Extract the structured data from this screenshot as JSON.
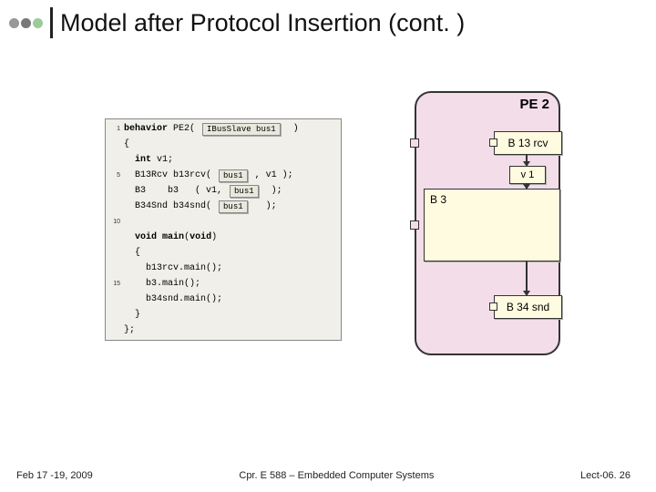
{
  "title": "Model after Protocol Insertion (cont. )",
  "code": {
    "l1a": "behavior",
    "l1b": " PE2( ",
    "l1pill": "IBusSlave bus1",
    "l1c": "  )",
    "l2": "{",
    "l3a": "  ",
    "l3b": "int",
    "l3c": " v1;",
    "l5a": "  B13Rcv b13rcv( ",
    "l5pill": "bus1",
    "l5b": " , v1 );",
    "l7a": "  B3    b3   ( v1, ",
    "l7pill": "bus1",
    "l7b": "  );",
    "l9a": "  B34Snd b34snd( ",
    "l9pill": "bus1",
    "l9b": "   );",
    "l12a": "  ",
    "l12b": "void",
    "l12c": " ",
    "l12d": "main",
    "l12e": "(",
    "l12f": "void",
    "l12g": ")",
    "l13": "  {",
    "l14": "    b13rcv.main();",
    "l15": "    b3.main();",
    "l16": "    b34snd.main();",
    "l17": "  }",
    "l18": "};"
  },
  "ln": {
    "n1": "1",
    "n5": "5",
    "n10": "10",
    "n15": "15"
  },
  "diagram": {
    "pe2": "PE 2",
    "b13rcv": "B 13 rcv",
    "v1": "v 1",
    "b3": "B 3",
    "b34snd": "B 34 snd"
  },
  "footer": {
    "left": "Feb 17 -19, 2009",
    "center": "Cpr. E 588 – Embedded Computer Systems",
    "right": "Lect-06. 26"
  }
}
